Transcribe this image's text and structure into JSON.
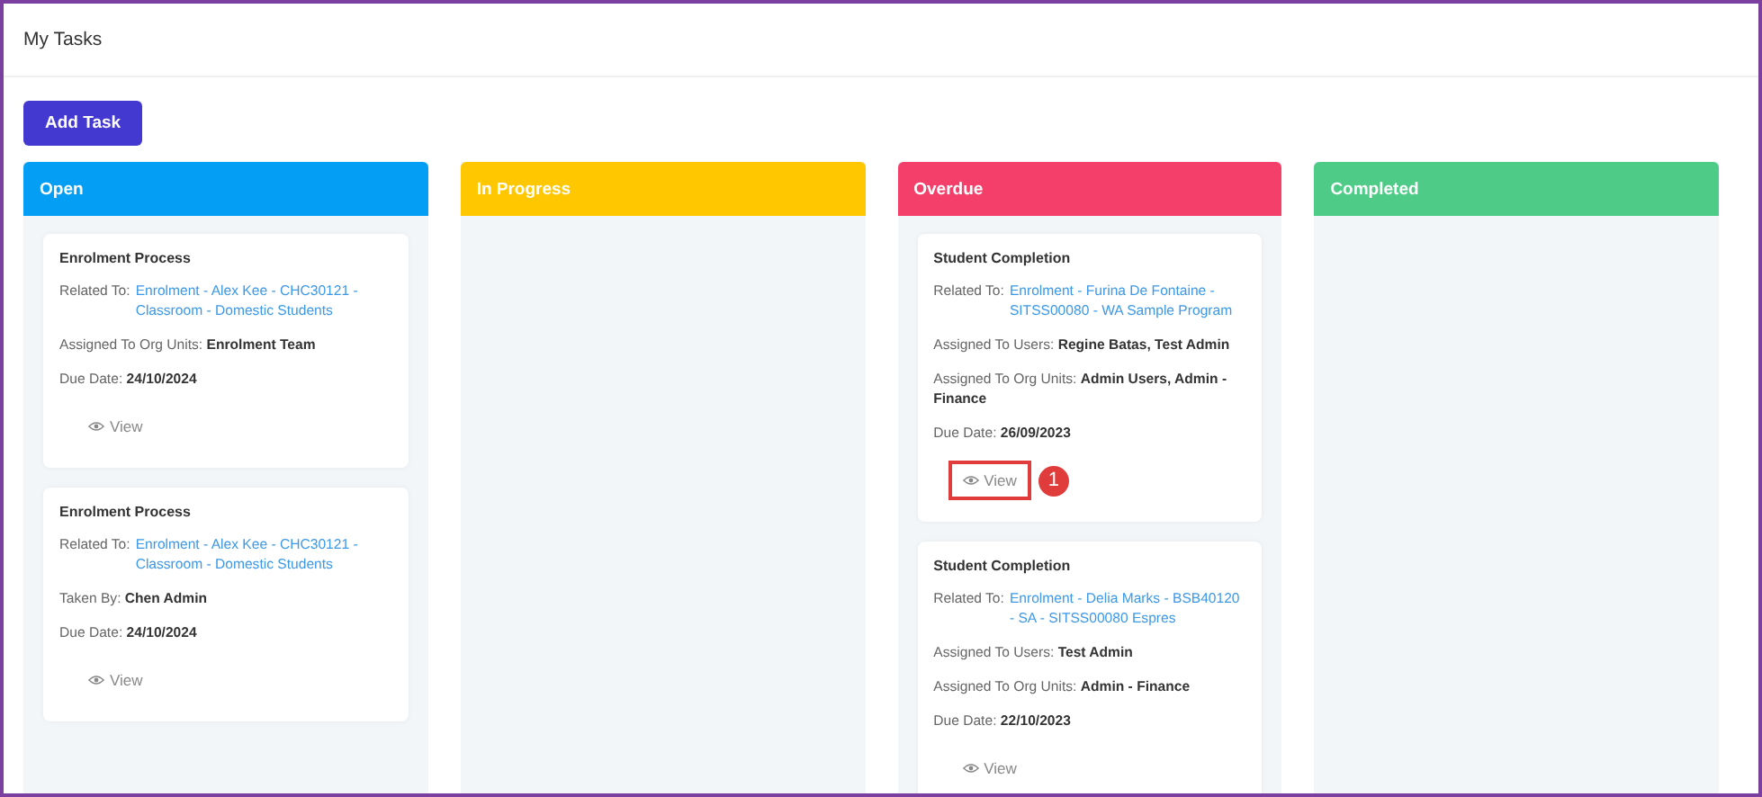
{
  "page": {
    "title": "My Tasks"
  },
  "add_button": {
    "label": "Add Task"
  },
  "columns": [
    {
      "title": "Open",
      "color": "#049ef4",
      "tasks": [
        {
          "title": "Enrolment Process",
          "related_label": "Related To:",
          "related_link": "Enrolment - Alex Kee - CHC30121 - Classroom - Domestic Students",
          "details": [
            {
              "label": "Assigned To Org Units:",
              "value": "Enrolment Team"
            },
            {
              "label": "Due Date:",
              "value": "24/10/2024"
            }
          ],
          "view": "View",
          "highlighted": false
        },
        {
          "title": "Enrolment Process",
          "related_label": "Related To:",
          "related_link": "Enrolment - Alex Kee - CHC30121 - Classroom - Domestic Students",
          "details": [
            {
              "label": "Taken By:",
              "value": "Chen Admin"
            },
            {
              "label": "Due Date:",
              "value": "24/10/2024"
            }
          ],
          "view": "View",
          "highlighted": false
        }
      ]
    },
    {
      "title": "In Progress",
      "color": "#ffc700"
    },
    {
      "title": "Overdue",
      "color": "#f43f6b",
      "tasks": [
        {
          "title": "Student Completion",
          "related_label": "Related To:",
          "related_link": "Enrolment - Furina De Fontaine - SITSS00080 - WA Sample Program",
          "details": [
            {
              "label": "Assigned To Users:",
              "value": "Regine Batas, Test Admin"
            },
            {
              "label": "Assigned To Org Units:",
              "value": "Admin Users, Admin - Finance"
            },
            {
              "label": "Due Date:",
              "value": "26/09/2023"
            }
          ],
          "view": "View",
          "highlighted": true,
          "callout": "1"
        },
        {
          "title": "Student Completion",
          "related_label": "Related To:",
          "related_link": "Enrolment - Delia Marks - BSB40120 - SA - SITSS00080 Espres",
          "details": [
            {
              "label": "Assigned To Users:",
              "value": "Test Admin"
            },
            {
              "label": "Assigned To Org Units:",
              "value": "Admin - Finance"
            },
            {
              "label": "Due Date:",
              "value": "22/10/2023"
            }
          ],
          "view": "View",
          "highlighted": false
        }
      ]
    },
    {
      "title": "Completed",
      "color": "#4ecb86"
    }
  ]
}
